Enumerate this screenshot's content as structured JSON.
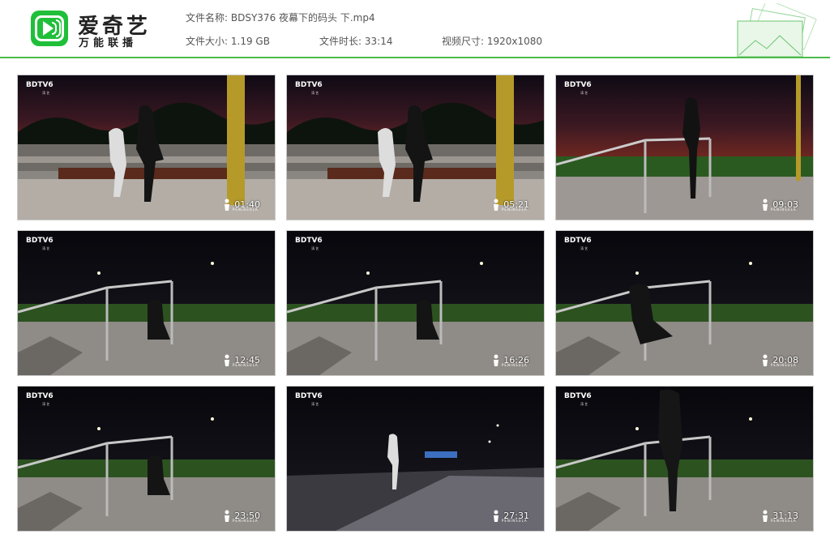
{
  "app": {
    "logo_title": "爱奇艺",
    "logo_subtitle": "万能联播",
    "brand_color": "#1fbf3a"
  },
  "file_info": {
    "name_label": "文件名称:",
    "name_value": "BDSY376 夜幕下的码头 下.mp4",
    "size_label": "文件大小:",
    "size_value": "1.19 GB",
    "duration_label": "文件时长:",
    "duration_value": "33:14",
    "resolution_label": "视频尺寸:",
    "resolution_value": "1920x1080"
  },
  "thumbnails": [
    {
      "tag": "BDTV6",
      "tag_sub": "涛 艺",
      "time": "01:40",
      "wm": "PENINSULA"
    },
    {
      "tag": "BDTV6",
      "tag_sub": "涛 艺",
      "time": "05:21",
      "wm": "PENINSULA"
    },
    {
      "tag": "BDTV6",
      "tag_sub": "涛 艺",
      "time": "09:03",
      "wm": "PENINSULA"
    },
    {
      "tag": "BDTV6",
      "tag_sub": "涛 艺",
      "time": "12:45",
      "wm": "PENINSULA"
    },
    {
      "tag": "BDTV6",
      "tag_sub": "涛 艺",
      "time": "16:26",
      "wm": "PENINSULA"
    },
    {
      "tag": "BDTV6",
      "tag_sub": "涛 艺",
      "time": "20:08",
      "wm": "PENINSULA"
    },
    {
      "tag": "BDTV6",
      "tag_sub": "涛 艺",
      "time": "23:50",
      "wm": "PENINSULA"
    },
    {
      "tag": "BDTV6",
      "tag_sub": "涛 艺",
      "time": "27:31",
      "wm": "PENINSULA"
    },
    {
      "tag": "BDTV6",
      "tag_sub": "涛 艺",
      "time": "31:13",
      "wm": "PENINSULA"
    }
  ]
}
